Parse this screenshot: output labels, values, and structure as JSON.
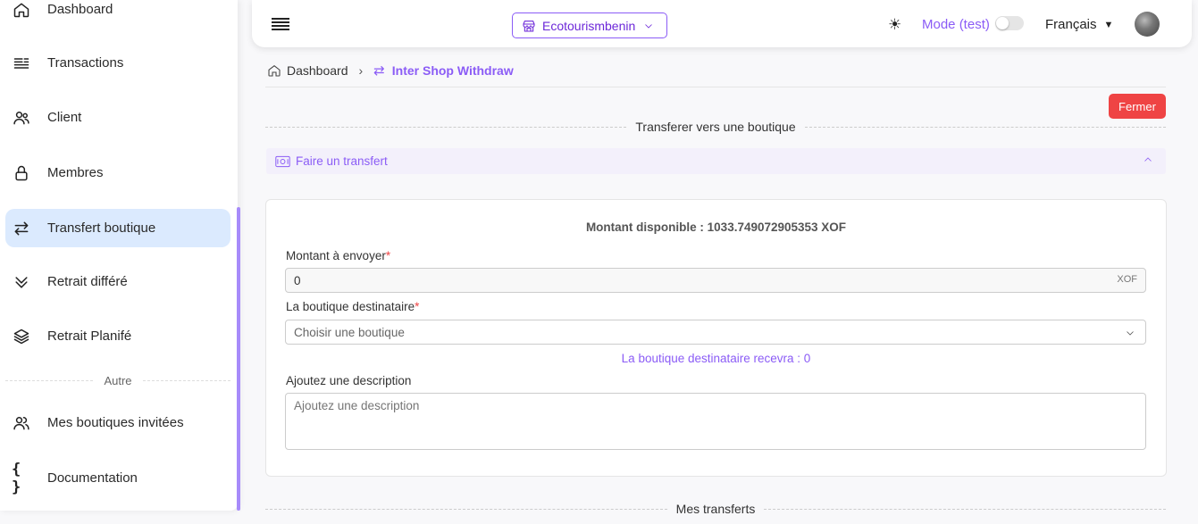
{
  "sidebar": {
    "items": [
      {
        "label": "Dashboard",
        "icon": "home-icon"
      },
      {
        "label": "Transactions",
        "icon": "list-icon"
      },
      {
        "label": "Client",
        "icon": "users-icon"
      },
      {
        "label": "Membres",
        "icon": "lock-icon"
      },
      {
        "label": "Transfert boutique",
        "icon": "transfer-arrows-icon",
        "active": true
      },
      {
        "label": "Retrait différé",
        "icon": "double-chevron-down-icon"
      },
      {
        "label": "Retrait Planifé",
        "icon": "layers-icon"
      },
      {
        "label": "Mes boutiques invitées",
        "icon": "users-icon"
      },
      {
        "label": "Documentation",
        "icon": "braces-icon"
      }
    ],
    "section_other": "Autre"
  },
  "header": {
    "shop_name": "Ecotourismbenin",
    "mode_label": "Mode (test)",
    "mode_enabled": false,
    "language": "Français"
  },
  "breadcrumb": {
    "home": "Dashboard",
    "current": "Inter Shop Withdraw"
  },
  "main": {
    "close_label": "Fermer",
    "section_title": "Transferer vers une boutique",
    "accordion_title": "Faire un transfert",
    "balance_text": "Montant disponible : 1033.749072905353 XOF",
    "amount_label": "Montant à envoyer",
    "amount_value": "0",
    "amount_suffix": "XOF",
    "shop_label": "La boutique destinataire",
    "shop_placeholder": "Choisir une boutique",
    "receive_text": "La boutique destinataire recevra : 0",
    "description_label": "Ajoutez une description",
    "description_placeholder": "Ajoutez une description",
    "transfers_title": "Mes transferts"
  },
  "colors": {
    "accent": "#8b5cf6",
    "danger": "#ef4444",
    "active_nav": "#dbeafe"
  }
}
